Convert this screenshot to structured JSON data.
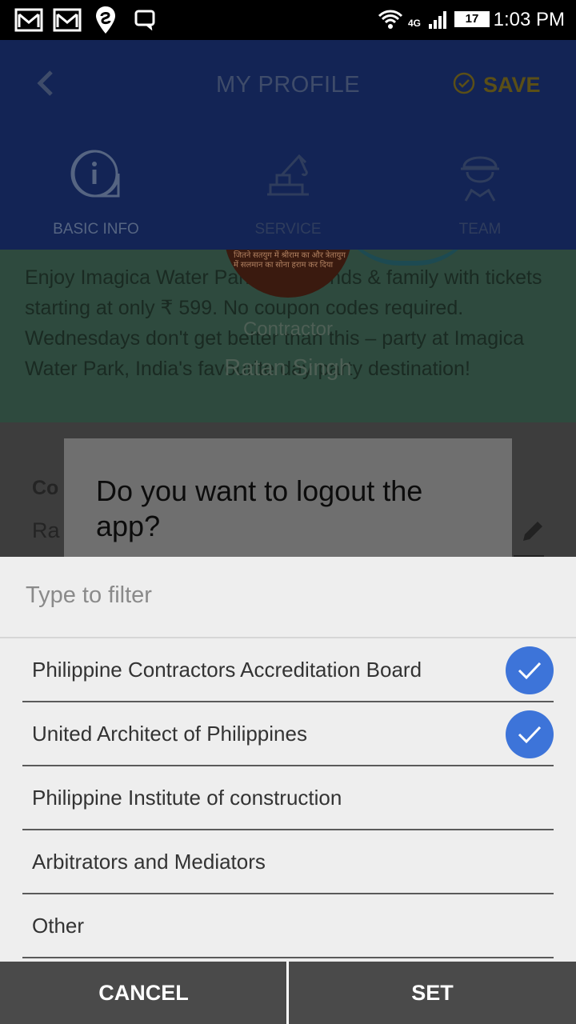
{
  "status_bar": {
    "time": "1:03 PM",
    "battery": "17",
    "network": "4G",
    "icons": [
      "gmail-icon",
      "gmail-icon",
      "swiggy-icon",
      "chat-icon",
      "wifi-icon",
      "signal-icon",
      "battery-icon"
    ]
  },
  "header": {
    "title": "MY PROFILE",
    "save_label": "SAVE",
    "tabs": [
      {
        "label": "BASIC INFO",
        "icon": "info-icon"
      },
      {
        "label": "SERVICE",
        "icon": "crane-icon"
      },
      {
        "label": "TEAM",
        "icon": "worker-icon"
      }
    ]
  },
  "background": {
    "banner_text": "Enjoy Imagica Water Park with friends & family with tickets starting at only ₹ 599. No coupon codes required. Wednesdays don't get better than this – party at Imagica Water Park, India's favourite day party destination!",
    "role": "Contractor",
    "user_name": "Ratan Singh",
    "avatar_text": "जितने सतयुग में श्रीराम का और त्रेतायुग में सलमान का सोना हराम कर दिया",
    "field_label": "Co",
    "field_value": "Ra"
  },
  "dialog": {
    "title": "Do you want to logout the app?"
  },
  "picker": {
    "filter_placeholder": "Type to filter",
    "items": [
      {
        "label": "Philippine Contractors Accreditation Board",
        "checked": true
      },
      {
        "label": "United Architect of Philippines",
        "checked": true
      },
      {
        "label": "Philippine Institute of construction",
        "checked": false
      },
      {
        "label": "Arbitrators and Mediators",
        "checked": false
      },
      {
        "label": "Other",
        "checked": false
      }
    ],
    "cancel_label": "CANCEL",
    "set_label": "SET"
  },
  "colors": {
    "header_bg": "#132455",
    "check_blue": "#3d74d9",
    "sheet_bg": "#eeeeee",
    "button_bg": "#4a4a4a"
  }
}
